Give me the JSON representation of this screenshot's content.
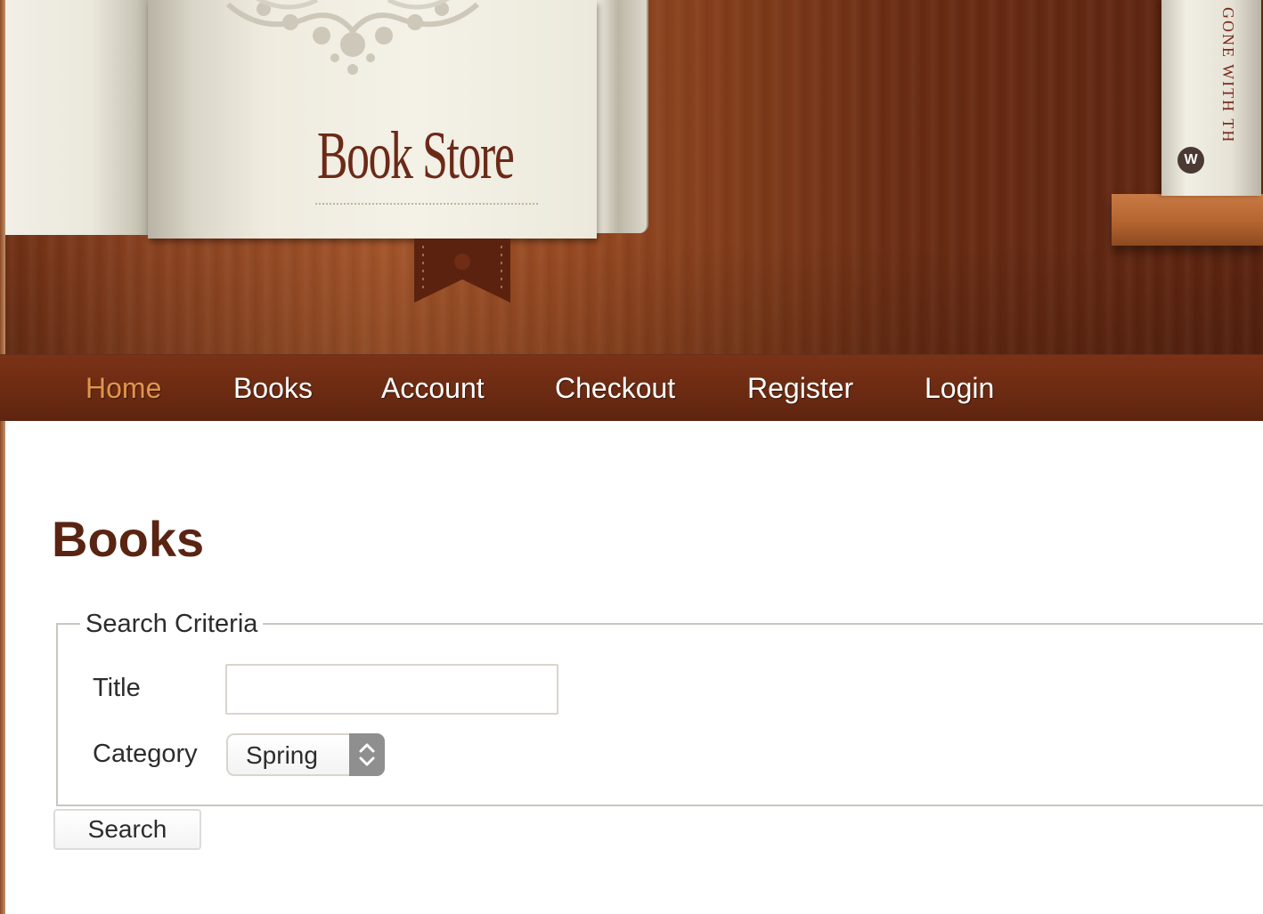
{
  "header": {
    "logo_text": "Book Store",
    "spine_text": "GONE WITH THE WIND",
    "spine_logo": "W"
  },
  "nav": {
    "items": [
      {
        "label": "Home",
        "active": true
      },
      {
        "label": "Books",
        "active": false
      },
      {
        "label": "Account",
        "active": false
      },
      {
        "label": "Checkout",
        "active": false
      },
      {
        "label": "Register",
        "active": false
      },
      {
        "label": "Login",
        "active": false
      }
    ]
  },
  "main": {
    "page_title": "Books",
    "search": {
      "legend": "Search Criteria",
      "title_label": "Title",
      "title_value": "",
      "category_label": "Category",
      "category_value": "Spring",
      "button_label": "Search"
    }
  },
  "colors": {
    "nav_background": "#6b2a12",
    "active_nav": "#e0954e",
    "heading": "#5a2412",
    "logo_text": "#6b2a18"
  }
}
